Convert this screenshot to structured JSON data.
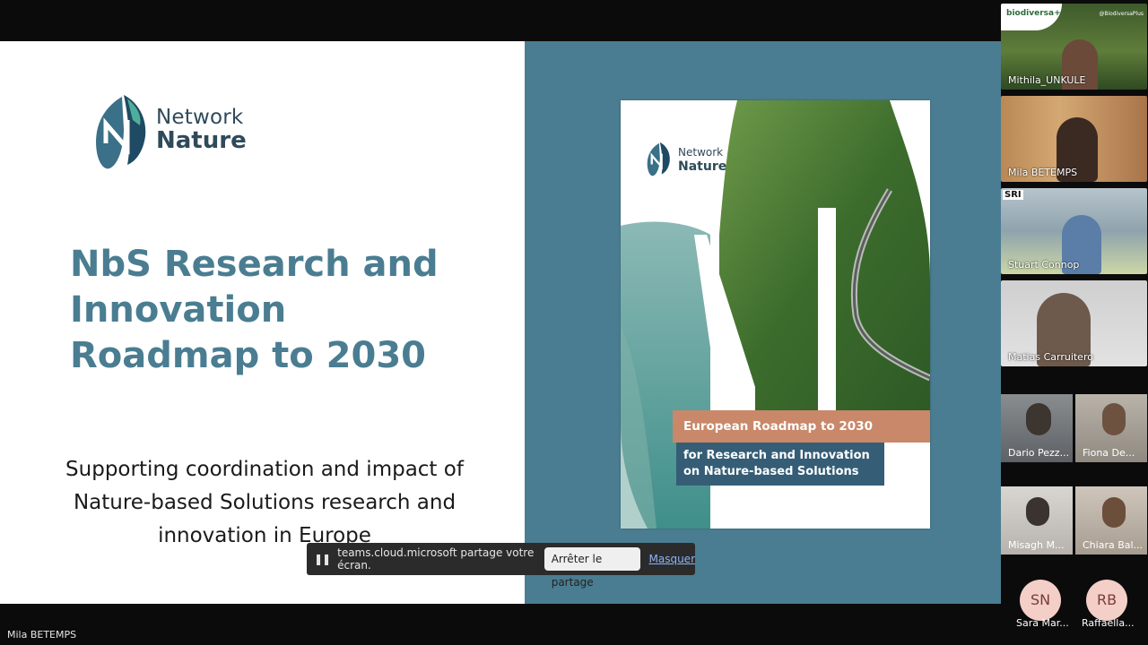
{
  "slide": {
    "logo": {
      "line1": "Network",
      "line2": "Nature"
    },
    "title": "NbS Research and Innovation Roadmap to 2030",
    "subtitle": "Supporting coordination and impact of Nature-based Solutions research and innovation in Europe",
    "cover": {
      "logo_line1": "Network",
      "logo_line2": "Nature",
      "band1": "European Roadmap to 2030",
      "band2_line1": "for Research and Innovation",
      "band2_line2": "on Nature-based Solutions"
    },
    "colors": {
      "teal": "#4a7d91",
      "copper": "#c98869",
      "navy": "#355d76"
    }
  },
  "sharebar": {
    "pause_icon": "pause-icon",
    "message": "teams.cloud.microsoft partage votre écran.",
    "stop_label": "Arrêter le partage",
    "hide_label": "Masquer"
  },
  "presenter_name": "Mila BETEMPS",
  "participants": [
    {
      "name": "Mithila_UNKULE",
      "brand": "biodiversa+",
      "handle": "@BiodiversaPlus"
    },
    {
      "name": "Mila BETEMPS"
    },
    {
      "name": "Stuart Connop",
      "brand": "SRI"
    },
    {
      "name": "Matias Carruitero"
    },
    {
      "name": "Dario Pezz..."
    },
    {
      "name": "Fiona De..."
    },
    {
      "name": "Misagh M..."
    },
    {
      "name": "Chiara Bal..."
    },
    {
      "name": "Sara Mar...",
      "initials": "SN"
    },
    {
      "name": "Raffaella...",
      "initials": "RB"
    }
  ]
}
